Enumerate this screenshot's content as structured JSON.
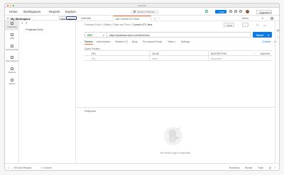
{
  "window": {
    "title": "Postman"
  },
  "nav": {
    "home": "Home",
    "workspaces": "Workspaces",
    "reports": "Reports",
    "explore": "Explore",
    "search_placeholder": "Search Postman",
    "invite": "Invite",
    "upgrade": "Upgrade"
  },
  "sidebar": {
    "workspace": "My Workspace",
    "new": "New",
    "import": "Import",
    "rail": [
      {
        "label": "Collections",
        "icon": "collections-icon"
      },
      {
        "label": "APIs",
        "icon": "apis-icon"
      },
      {
        "label": "Environments",
        "icon": "environments-icon"
      },
      {
        "label": "Mock Servers",
        "icon": "mock-servers-icon"
      },
      {
        "label": "Monitors",
        "icon": "monitors-icon"
      },
      {
        "label": "History",
        "icon": "history-icon"
      }
    ],
    "collection_item": "Postman Echo"
  },
  "tabs": {
    "overview": "Overview",
    "current": "Current UTC time",
    "environment": "Demo"
  },
  "request": {
    "breadcrumb": [
      "Postman Echo",
      "Utilities / Date and Time",
      "Current UTC time"
    ],
    "save": "Save",
    "method": "GET",
    "url": "https://postman-echo.com/time/now",
    "send": "Send",
    "tabs": [
      "Params",
      "Authorization",
      "Headers (7)",
      "Body",
      "Pre-request Script",
      "Tests",
      "Settings"
    ],
    "active_tab": "Params",
    "right_links": [
      "Cookies"
    ],
    "query_params_label": "Query Params",
    "columns": [
      "KEY",
      "VALUE",
      "DESCRIPTION"
    ],
    "bulk_edit": "Bulk Edit",
    "placeholders": [
      "Key",
      "Value",
      "Description"
    ]
  },
  "response": {
    "label": "Response",
    "message": "Hit Send to get a response"
  },
  "status": {
    "find_replace": "Find and Replace",
    "console": "Console",
    "bootcamp": "Bootcamp",
    "runner": "Runner",
    "trash": "Trash"
  },
  "colors": {
    "accent_orange": "#ff6c37",
    "primary_blue": "#097bed",
    "get_green": "#22863a"
  }
}
